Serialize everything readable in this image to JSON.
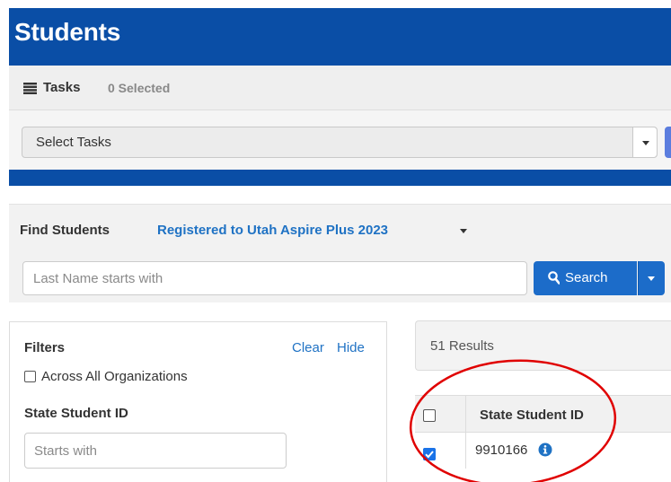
{
  "header": {
    "title": "Students"
  },
  "tasks": {
    "label": "Tasks",
    "selected_count": "0 Selected",
    "select_value": "Select Tasks"
  },
  "find": {
    "label": "Find Students",
    "scope": "Registered to Utah Aspire Plus 2023",
    "search_placeholder": "Last Name starts with",
    "search_button": "Search"
  },
  "filters": {
    "title": "Filters",
    "clear": "Clear",
    "hide": "Hide",
    "across_label": "Across All Organizations",
    "across_checked": false,
    "ssid_label": "State Student ID",
    "ssid_placeholder": "Starts with"
  },
  "results": {
    "count": "51 Results",
    "column_header": "State Student ID",
    "rows": [
      {
        "state_student_id": "9910166",
        "checked": true
      }
    ]
  },
  "colors": {
    "header_bg": "#0a4ea6",
    "link": "#1f72c4",
    "primary_button": "#1c6cc9",
    "checkbox_checked": "#1a73e8",
    "annotation": "#e00000"
  },
  "icons": {
    "tasks": "list-icon",
    "search": "magnifier-icon",
    "info": "info-circle-icon"
  }
}
